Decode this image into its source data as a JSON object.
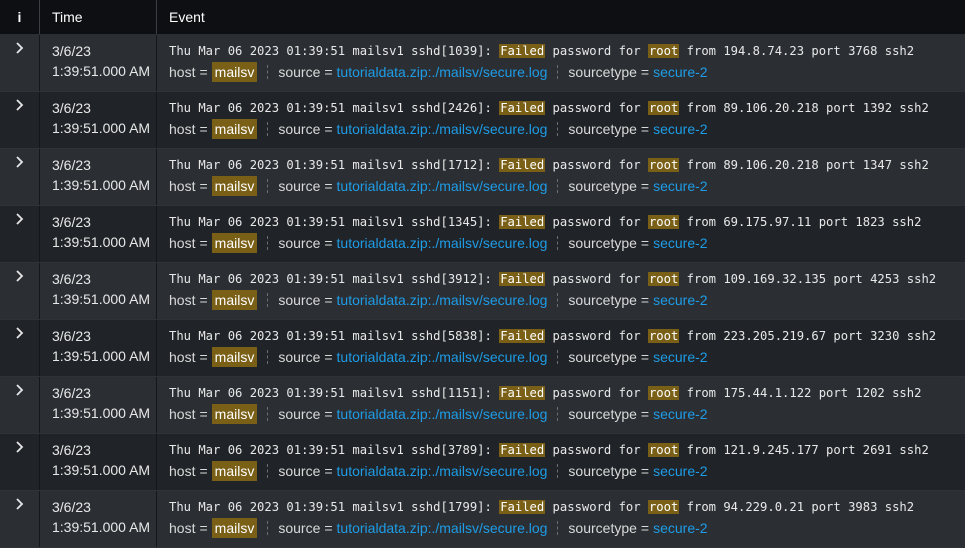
{
  "header": {
    "info": "i",
    "time": "Time",
    "event": "Event"
  },
  "field_labels": {
    "host": "host",
    "source": "source",
    "sourcetype": "sourcetype",
    "equals": "="
  },
  "rows": [
    {
      "date": "3/6/23",
      "time": "1:39:51.000 AM",
      "prefix": "Thu Mar 06 2023 01:39:51 mailsv1 sshd[1039]: ",
      "failed": "Failed",
      "mid": " password for ",
      "root": "root",
      "suffix": " from 194.8.74.23 port 3768 ssh2",
      "host": "mailsv",
      "source": "tutorialdata.zip:./mailsv/secure.log",
      "sourcetype": "secure-2"
    },
    {
      "date": "3/6/23",
      "time": "1:39:51.000 AM",
      "prefix": "Thu Mar 06 2023 01:39:51 mailsv1 sshd[2426]: ",
      "failed": "Failed",
      "mid": " password for ",
      "root": "root",
      "suffix": " from 89.106.20.218 port 1392 ssh2",
      "host": "mailsv",
      "source": "tutorialdata.zip:./mailsv/secure.log",
      "sourcetype": "secure-2"
    },
    {
      "date": "3/6/23",
      "time": "1:39:51.000 AM",
      "prefix": "Thu Mar 06 2023 01:39:51 mailsv1 sshd[1712]: ",
      "failed": "Failed",
      "mid": " password for ",
      "root": "root",
      "suffix": " from 89.106.20.218 port 1347 ssh2",
      "host": "mailsv",
      "source": "tutorialdata.zip:./mailsv/secure.log",
      "sourcetype": "secure-2"
    },
    {
      "date": "3/6/23",
      "time": "1:39:51.000 AM",
      "prefix": "Thu Mar 06 2023 01:39:51 mailsv1 sshd[1345]: ",
      "failed": "Failed",
      "mid": " password for ",
      "root": "root",
      "suffix": " from 69.175.97.11 port 1823 ssh2",
      "host": "mailsv",
      "source": "tutorialdata.zip:./mailsv/secure.log",
      "sourcetype": "secure-2"
    },
    {
      "date": "3/6/23",
      "time": "1:39:51.000 AM",
      "prefix": "Thu Mar 06 2023 01:39:51 mailsv1 sshd[3912]: ",
      "failed": "Failed",
      "mid": " password for ",
      "root": "root",
      "suffix": " from 109.169.32.135 port 4253 ssh2",
      "host": "mailsv",
      "source": "tutorialdata.zip:./mailsv/secure.log",
      "sourcetype": "secure-2"
    },
    {
      "date": "3/6/23",
      "time": "1:39:51.000 AM",
      "prefix": "Thu Mar 06 2023 01:39:51 mailsv1 sshd[5838]: ",
      "failed": "Failed",
      "mid": " password for ",
      "root": "root",
      "suffix": " from 223.205.219.67 port 3230 ssh2",
      "host": "mailsv",
      "source": "tutorialdata.zip:./mailsv/secure.log",
      "sourcetype": "secure-2"
    },
    {
      "date": "3/6/23",
      "time": "1:39:51.000 AM",
      "prefix": "Thu Mar 06 2023 01:39:51 mailsv1 sshd[1151]: ",
      "failed": "Failed",
      "mid": " password for ",
      "root": "root",
      "suffix": " from 175.44.1.122 port 1202 ssh2",
      "host": "mailsv",
      "source": "tutorialdata.zip:./mailsv/secure.log",
      "sourcetype": "secure-2"
    },
    {
      "date": "3/6/23",
      "time": "1:39:51.000 AM",
      "prefix": "Thu Mar 06 2023 01:39:51 mailsv1 sshd[3789]: ",
      "failed": "Failed",
      "mid": " password for ",
      "root": "root",
      "suffix": " from 121.9.245.177 port 2691 ssh2",
      "host": "mailsv",
      "source": "tutorialdata.zip:./mailsv/secure.log",
      "sourcetype": "secure-2"
    },
    {
      "date": "3/6/23",
      "time": "1:39:51.000 AM",
      "prefix": "Thu Mar 06 2023 01:39:51 mailsv1 sshd[1799]: ",
      "failed": "Failed",
      "mid": " password for ",
      "root": "root",
      "suffix": " from 94.229.0.21 port 3983 ssh2",
      "host": "mailsv",
      "source": "tutorialdata.zip:./mailsv/secure.log",
      "sourcetype": "secure-2"
    }
  ]
}
